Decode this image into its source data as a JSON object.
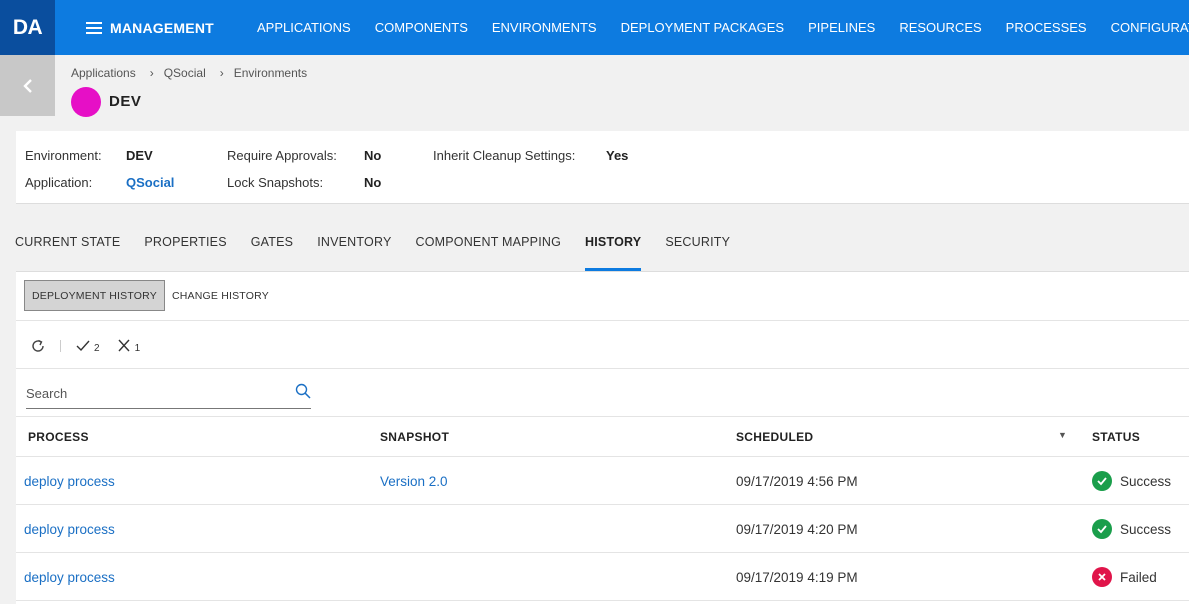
{
  "app": {
    "logo": "DA",
    "section": "MANAGEMENT"
  },
  "nav": [
    "APPLICATIONS",
    "COMPONENTS",
    "ENVIRONMENTS",
    "DEPLOYMENT PACKAGES",
    "PIPELINES",
    "RESOURCES",
    "PROCESSES",
    "CONFIGURATIONS"
  ],
  "breadcrumb": [
    "Applications",
    "QSocial",
    "Environments"
  ],
  "environment": {
    "name": "DEV",
    "color": "#e60fc6"
  },
  "info": {
    "environment_label": "Environment:",
    "environment_value": "DEV",
    "application_label": "Application:",
    "application_value": "QSocial",
    "require_approvals_label": "Require Approvals:",
    "require_approvals_value": "No",
    "lock_snapshots_label": "Lock Snapshots:",
    "lock_snapshots_value": "No",
    "inherit_cleanup_label": "Inherit Cleanup Settings:",
    "inherit_cleanup_value": "Yes"
  },
  "tabs": [
    "CURRENT STATE",
    "PROPERTIES",
    "GATES",
    "INVENTORY",
    "COMPONENT MAPPING",
    "HISTORY",
    "SECURITY"
  ],
  "active_tab": "HISTORY",
  "subtabs": {
    "deployment_history": "DEPLOYMENT HISTORY",
    "change_history": "CHANGE HISTORY"
  },
  "toolbar": {
    "success_count": "2",
    "failed_count": "1"
  },
  "search": {
    "placeholder": "Search"
  },
  "table": {
    "headers": {
      "process": "PROCESS",
      "snapshot": "SNAPSHOT",
      "scheduled": "SCHEDULED",
      "status": "STATUS"
    },
    "rows": [
      {
        "process": "deploy process",
        "snapshot": "Version 2.0",
        "scheduled": "09/17/2019 4:56 PM",
        "status": "Success"
      },
      {
        "process": "deploy process",
        "snapshot": "",
        "scheduled": "09/17/2019 4:20 PM",
        "status": "Success"
      },
      {
        "process": "deploy process",
        "snapshot": "",
        "scheduled": "09/17/2019 4:19 PM",
        "status": "Failed"
      }
    ]
  },
  "colors": {
    "brand": "#0d7be0",
    "success": "#1a9e4b",
    "failed": "#e0144a",
    "link": "#1a6fc4"
  }
}
